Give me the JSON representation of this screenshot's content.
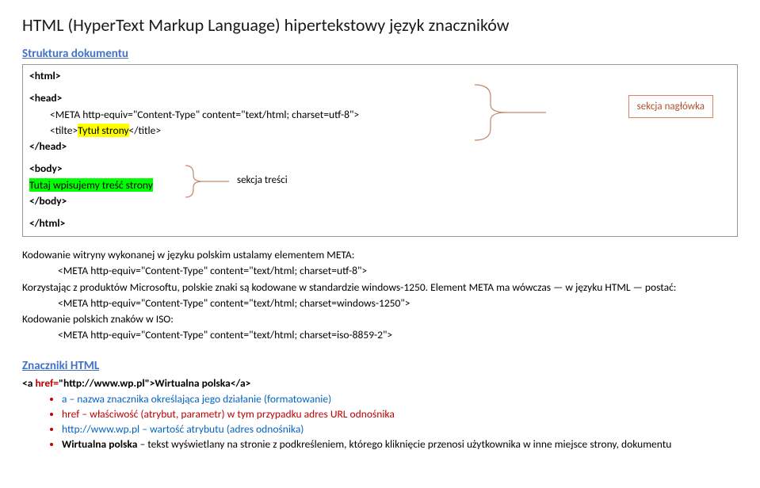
{
  "title": "HTML (HyperText Markup Language) hipertekstowy język znaczników",
  "section1_heading": "Struktura dokumentu",
  "code": {
    "html_open": "<html>",
    "head_open": "<head>",
    "meta1": "<META http-equiv=\"Content-Type\" content=\"text/html; charset=utf-8\">",
    "title_open": "<tilte>",
    "title_text": "Tytuł strony",
    "title_close": "</title>",
    "head_close": "</head>",
    "body_open": "<body>",
    "body_text": "Tutaj wpisujemy treść strony",
    "body_close": "</body>",
    "html_close": "</html>"
  },
  "label1": "sekcja nagłówka",
  "label2": "sekcja treści",
  "encoding": {
    "l1": "Kodowanie witryny wykonanej w języku polskim ustalamy elementem META:",
    "l2": "<META http-equiv=\"Content-Type\" content=\"text/html; charset=utf-8\">",
    "l3": "Korzystając z produktów Microsoftu, polskie znaki są kodowane w standardzie windows-1250. Element META ma wówczas — w języku HTML — postać:",
    "l4": "<META http-equiv=\"Content-Type\" content=\"text/html; charset=windows-1250\">",
    "l5": "Kodowanie polskich znaków w ISO:",
    "l6": "<META http-equiv=\"Content-Type\" content=\"text/html; charset=iso-8859-2\">"
  },
  "section2_heading": "Znaczniki HTML",
  "anchor": {
    "open1": "<a",
    "attr": " href=",
    "val": "\"http://www.wp.pl\"",
    "open2": ">",
    "text": "Wirtualna polska",
    "close": "</a>"
  },
  "bullets": {
    "b1": "a – nazwa znacznika określająca jego działanie (formatowanie)",
    "b2": "href – właściwość (atrybut, parametr) w tym przypadku adres URL odnośnika",
    "b3": "http://www.wp.pl – wartość atrybutu (adres odnośnika)",
    "b4a": "Wirtualna polska ",
    "b4b": " – tekst wyświetlany na stronie z podkreśleniem, którego kliknięcie przenosi użytkownika w inne miejsce strony, dokumentu"
  }
}
